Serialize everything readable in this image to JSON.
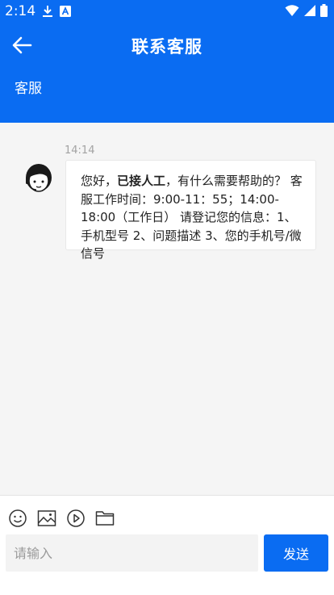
{
  "status_bar": {
    "time": "2:14",
    "left_icons": [
      "download-icon",
      "font-a-icon"
    ],
    "right_icons": [
      "wifi-icon",
      "cell-signal-icon",
      "battery-icon"
    ]
  },
  "header": {
    "title": "联系客服",
    "back_icon": "arrow-left-icon",
    "sub_tab": "客服",
    "color": "#0a6cf2"
  },
  "messages": [
    {
      "time": "14:14",
      "sender": "agent",
      "avatar_icon": "agent-headset-avatar-icon",
      "text_prefix": "您好，",
      "text_bold": "已接人工",
      "text_suffix": "，有什么需要帮助的？ 客服工作时间：9:00-11：55；14:00-18:00（工作日） 请登记您的信息：1、手机型号 2、问题描述 3、您的手机号/微信号"
    }
  ],
  "toolbar": {
    "items": [
      "emoji-icon",
      "image-icon",
      "video-icon",
      "folder-icon"
    ]
  },
  "composer": {
    "placeholder": "请输入",
    "value": "",
    "send_label": "发送"
  }
}
